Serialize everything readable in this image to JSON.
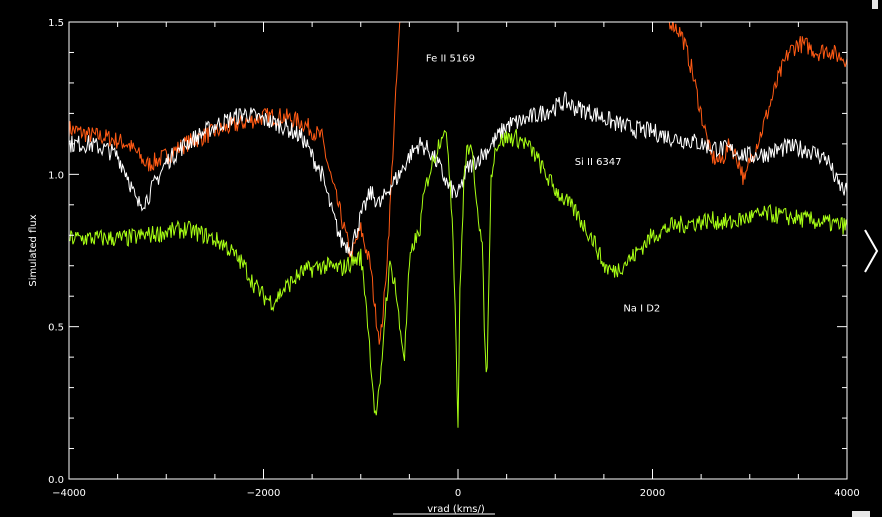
{
  "chart_data": {
    "type": "line",
    "title": "",
    "xlabel": "vrad (kms/)",
    "ylabel": "Simulated flux",
    "xlim": [
      -4000,
      4000
    ],
    "ylim": [
      0.0,
      1.5
    ],
    "x_ticks": [
      -4000,
      -2000,
      0,
      2000,
      4000
    ],
    "x_tick_labels": [
      "−4000",
      "−2000",
      "0",
      "2000",
      "4000"
    ],
    "y_ticks": [
      0.0,
      0.5,
      1.0,
      1.5
    ],
    "y_tick_labels": [
      "0.0",
      "0.5",
      "1.0",
      "1.5"
    ],
    "grid": false,
    "series": [
      {
        "name": "Fe II 5169",
        "color": "#ff5a14",
        "label_at": [
          -330,
          1.37
        ],
        "x": [
          -4000,
          -3800,
          -3600,
          -3400,
          -3300,
          -3200,
          -3000,
          -2800,
          -2500,
          -2200,
          -2000,
          -1800,
          -1600,
          -1400,
          -1300,
          -1200,
          -1100,
          -1000,
          -900,
          -850,
          -800,
          -750,
          -700,
          -650,
          -600,
          -550,
          -500,
          1000,
          1200,
          1500,
          1800,
          2000,
          2200,
          2300,
          2400,
          2500,
          2600,
          2700,
          2800,
          2900,
          2950,
          3000,
          3100,
          3200,
          3300,
          3400,
          3500,
          3600,
          3700,
          3800,
          3900,
          4000
        ],
        "y": [
          1.15,
          1.13,
          1.12,
          1.1,
          1.07,
          1.03,
          1.06,
          1.1,
          1.14,
          1.17,
          1.19,
          1.19,
          1.17,
          1.12,
          0.98,
          0.86,
          0.73,
          0.82,
          0.7,
          0.55,
          0.45,
          0.62,
          0.88,
          1.2,
          1.48,
          1.7,
          1.82,
          1.65,
          1.6,
          1.56,
          1.55,
          1.53,
          1.5,
          1.46,
          1.35,
          1.2,
          1.06,
          1.04,
          1.1,
          1.03,
          0.97,
          1.05,
          1.12,
          1.22,
          1.32,
          1.4,
          1.43,
          1.42,
          1.4,
          1.41,
          1.39,
          1.38
        ]
      },
      {
        "name": "Si II 6347",
        "color": "#ffffff",
        "label_at": [
          1200,
          1.03
        ],
        "x": [
          -4000,
          -3800,
          -3600,
          -3500,
          -3400,
          -3300,
          -3200,
          -3000,
          -2800,
          -2500,
          -2200,
          -2000,
          -1800,
          -1600,
          -1400,
          -1300,
          -1200,
          -1100,
          -1000,
          -900,
          -800,
          -700,
          -600,
          -500,
          -400,
          -300,
          -200,
          -100,
          0,
          100,
          300,
          500,
          700,
          1000,
          1100,
          1200,
          1400,
          1600,
          1800,
          2000,
          2200,
          2400,
          2600,
          2800,
          3000,
          3200,
          3400,
          3600,
          3800,
          3900,
          4000
        ],
        "y": [
          1.1,
          1.1,
          1.08,
          1.06,
          1.0,
          0.9,
          0.92,
          1.04,
          1.1,
          1.16,
          1.2,
          1.18,
          1.16,
          1.12,
          1.0,
          0.88,
          0.78,
          0.76,
          0.86,
          0.94,
          0.9,
          0.96,
          1.0,
          1.06,
          1.1,
          1.08,
          1.03,
          0.96,
          0.93,
          1.02,
          1.08,
          1.16,
          1.18,
          1.22,
          1.24,
          1.22,
          1.2,
          1.17,
          1.15,
          1.14,
          1.12,
          1.11,
          1.09,
          1.08,
          1.06,
          1.07,
          1.09,
          1.08,
          1.05,
          0.97,
          0.94
        ]
      },
      {
        "name": "Na I D2",
        "color": "#a8ff14",
        "label_at": [
          1700,
          0.55
        ],
        "x": [
          -4000,
          -3800,
          -3600,
          -3400,
          -3200,
          -3000,
          -2800,
          -2600,
          -2400,
          -2200,
          -2100,
          -2000,
          -1900,
          -1800,
          -1600,
          -1400,
          -1200,
          -1100,
          -1000,
          -950,
          -900,
          -850,
          -800,
          -750,
          -700,
          -650,
          -600,
          -550,
          -500,
          -450,
          -400,
          -350,
          -300,
          -250,
          -200,
          -150,
          -100,
          -50,
          -20,
          0,
          20,
          60,
          100,
          150,
          200,
          250,
          280,
          300,
          320,
          340,
          360,
          400,
          500,
          600,
          700,
          800,
          900,
          1000,
          1200,
          1400,
          1500,
          1600,
          1800,
          2000,
          2200,
          2400,
          2600,
          2800,
          3000,
          3200,
          3400,
          3600,
          3800,
          4000
        ],
        "y": [
          0.79,
          0.79,
          0.79,
          0.79,
          0.8,
          0.81,
          0.82,
          0.8,
          0.77,
          0.7,
          0.64,
          0.6,
          0.58,
          0.62,
          0.68,
          0.7,
          0.69,
          0.71,
          0.73,
          0.6,
          0.4,
          0.2,
          0.3,
          0.55,
          0.7,
          0.65,
          0.5,
          0.4,
          0.7,
          0.78,
          0.8,
          0.93,
          1.0,
          1.05,
          1.1,
          1.15,
          1.08,
          0.8,
          0.45,
          0.18,
          0.6,
          0.98,
          1.1,
          1.05,
          0.9,
          0.75,
          0.4,
          0.35,
          0.7,
          0.98,
          1.05,
          1.1,
          1.12,
          1.12,
          1.1,
          1.06,
          1.0,
          0.95,
          0.88,
          0.78,
          0.7,
          0.68,
          0.73,
          0.8,
          0.83,
          0.84,
          0.85,
          0.84,
          0.86,
          0.87,
          0.86,
          0.85,
          0.84,
          0.83
        ]
      }
    ]
  }
}
